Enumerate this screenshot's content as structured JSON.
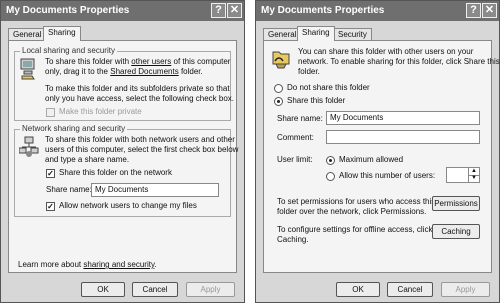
{
  "left_dialog": {
    "title": "My Documents Properties",
    "help_btn": "?",
    "close_btn": "✕",
    "tabs": [
      "General",
      "Sharing"
    ],
    "local": {
      "heading": "Local sharing and security",
      "line1_pre": "To share this folder with ",
      "line1_link": "other users",
      "line1_post": " of this computer",
      "line2_pre": "only, drag it to the ",
      "line2_link": "Shared Documents",
      "line2_post": " folder.",
      "private_line1": "To make this folder and its subfolders private so that",
      "private_line2": "only you have access, select the following check box.",
      "private_check": "Make this folder private"
    },
    "network": {
      "heading": "Network sharing and security",
      "line1": "To share this folder with both network users and other",
      "line2": "users of this computer, select the first check box below",
      "line3": "and type a share name.",
      "share_check": "Share this folder on the network",
      "share_name_label": "Share name:",
      "share_name_value": "My Documents",
      "change_check": "Allow network users to change my files"
    },
    "learn_pre": "Learn more about ",
    "learn_link": "sharing and security",
    "learn_post": ".",
    "ok": "OK",
    "cancel": "Cancel",
    "apply": "Apply"
  },
  "right_dialog": {
    "title": "My Documents Properties",
    "help_btn": "?",
    "close_btn": "✕",
    "tabs": [
      "General",
      "Sharing",
      "Security"
    ],
    "intro_line1": "You can share this folder with other users on your",
    "intro_line2": "network.  To enable sharing for this folder, click Share this",
    "intro_line3": "folder.",
    "do_not_share": "Do not share this folder",
    "share": "Share this folder",
    "share_name_label": "Share name:",
    "share_name_value": "My Documents",
    "comment_label": "Comment:",
    "comment_value": "",
    "user_limit_label": "User limit:",
    "max_allowed": "Maximum allowed",
    "allow_number": "Allow this number of users:",
    "perm_line1": "To set permissions for users who access this",
    "perm_line2": "folder over the network, click Permissions.",
    "permissions_btn": "Permissions",
    "cache_line1": "To configure settings for offline access, click",
    "cache_line2": "Caching.",
    "caching_btn": "Caching",
    "ok": "OK",
    "cancel": "Cancel",
    "apply": "Apply"
  }
}
